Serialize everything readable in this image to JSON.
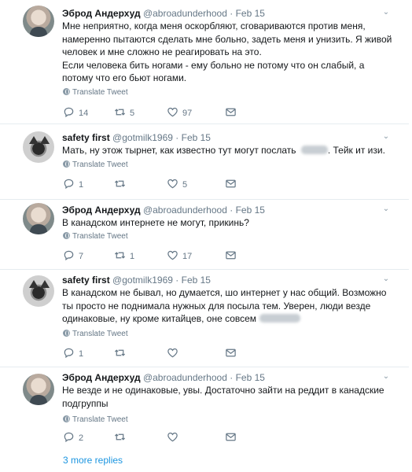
{
  "tweets": [
    {
      "name": "Эброд Андерхуд",
      "handle": "@abroadunderhood",
      "dot": "·",
      "date": "Feb 15",
      "avatar": "avatar-man-photo",
      "lines": [
        "Мне неприятно, когда меня оскорбляют, сговариваются против меня,",
        "намеренно пытаются сделать мне больно, задеть меня и унизить. Я живой",
        "человек и мне сложно не реагировать на это.",
        "Если человека бить ногами - ему больно не потому что он слабый, а",
        "потому что его бьют ногами."
      ],
      "translate": "Translate Tweet",
      "replies": "14",
      "retweets": "5",
      "likes": "97"
    },
    {
      "name": "safety first",
      "handle": "@gotmilk1969",
      "dot": "·",
      "date": "Feb 15",
      "avatar": "avatar-cat-photo",
      "line_before_blur": "Мать, ну этож тырнет, как известно тут могут послать",
      "line_after_blur": ". Тейк ит изи.",
      "translate": "Translate Tweet",
      "replies": "1",
      "retweets": "",
      "likes": "5"
    },
    {
      "name": "Эброд Андерхуд",
      "handle": "@abroadunderhood",
      "dot": "·",
      "date": "Feb 15",
      "avatar": "avatar-man-photo",
      "lines": [
        "В канадском интернете не могут, прикинь?"
      ],
      "translate": "Translate Tweet",
      "replies": "7",
      "retweets": "1",
      "likes": "17"
    },
    {
      "name": "safety first",
      "handle": "@gotmilk1969",
      "dot": "·",
      "date": "Feb 15",
      "avatar": "avatar-cat-photo",
      "lines": [
        "В канадском не бывал, но думается, шо интернет у нас общий. Возможно",
        "ты просто не поднимала нужных для посыла тем. Уверен, люди везде"
      ],
      "line_before_blur": "одинаковые, ну кроме китайцев, оне совсем",
      "translate": "Translate Tweet",
      "replies": "1",
      "retweets": "",
      "likes": ""
    },
    {
      "name": "Эброд Андерхуд",
      "handle": "@abroadunderhood",
      "dot": "·",
      "date": "Feb 15",
      "avatar": "avatar-man-photo",
      "lines": [
        "Не везде и не одинаковые, увы. Достаточно зайти на реддит в канадские",
        "подгруппы"
      ],
      "translate": "Translate Tweet",
      "replies": "2",
      "retweets": "",
      "likes": ""
    }
  ],
  "more_replies": "3 more replies"
}
